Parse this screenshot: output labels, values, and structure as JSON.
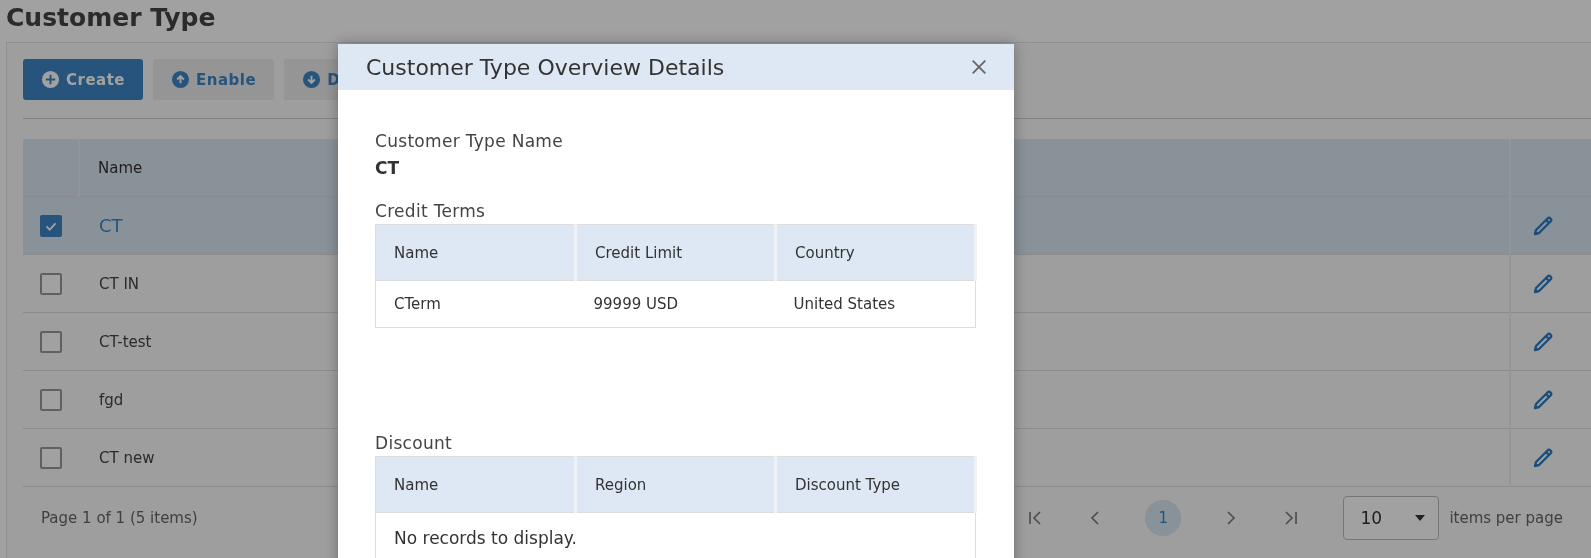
{
  "page": {
    "title": "Customer Type"
  },
  "toolbar": [
    {
      "label": "Create",
      "kind": "primary"
    },
    {
      "label": "Enable",
      "kind": "enable"
    },
    {
      "label": "D",
      "kind": "disable"
    }
  ],
  "table": {
    "columns": [
      "Name"
    ],
    "rows": [
      {
        "name": "CT",
        "selected": true
      },
      {
        "name": "CT IN",
        "selected": false
      },
      {
        "name": "CT-test",
        "selected": false
      },
      {
        "name": "fgd",
        "selected": false
      },
      {
        "name": "CT new",
        "selected": false
      }
    ],
    "summary": "Page 1 of 1 (5 items)",
    "pages": [
      {
        "label": "1",
        "selected": true
      }
    ],
    "page_size": "10",
    "page_size_label": "items per page"
  },
  "dialog": {
    "title": "Customer Type Overview Details",
    "name_label": "Customer Type Name",
    "name_value": "CT",
    "credit_terms": {
      "title": "Credit Terms",
      "columns": [
        "Name",
        "Credit Limit",
        "Country"
      ],
      "rows": [
        [
          "CTerm",
          "99999 USD",
          "United States"
        ]
      ]
    },
    "discount": {
      "title": "Discount",
      "columns": [
        "Name",
        "Region",
        "Discount Type"
      ],
      "empty": "No records to display."
    }
  }
}
